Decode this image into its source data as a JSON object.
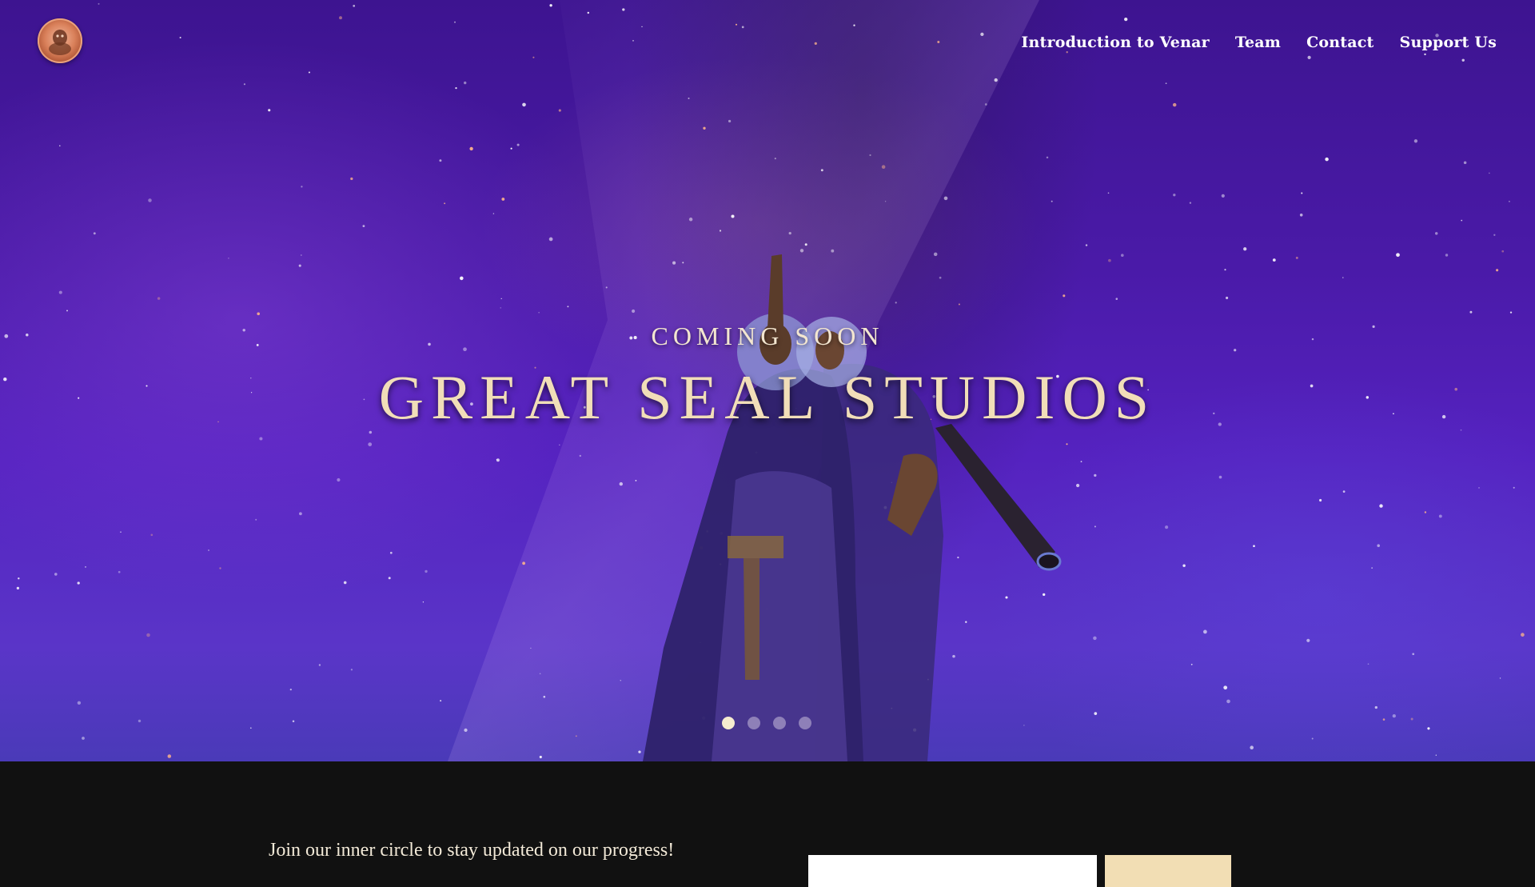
{
  "brand": {
    "logo_icon": "great-seal-logo-icon"
  },
  "nav": {
    "items": [
      {
        "label": "Introduction to Venar"
      },
      {
        "label": "Team"
      },
      {
        "label": "Contact"
      },
      {
        "label": "Support Us"
      }
    ]
  },
  "hero": {
    "subtitle": "COMING SOON",
    "title": "GREAT SEAL STUDIOS",
    "slides_total": 4,
    "active_slide": 1
  },
  "newsletter": {
    "text": "Join our inner circle to stay updated on our progress!",
    "email_placeholder": "",
    "button_label": ""
  },
  "colors": {
    "accent": "#f1deb8",
    "footer_bg": "#111111",
    "hero_purple": "#4a1aa8"
  }
}
